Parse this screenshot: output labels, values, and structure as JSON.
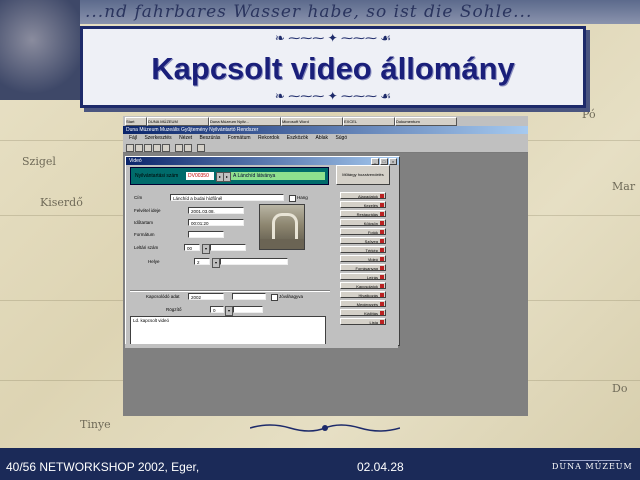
{
  "slide": {
    "script_text": "...nd fahrbares Wasser habe, so ist die Sohle...",
    "title": "Kapcsolt video állomány",
    "map_labels": [
      "Kiserdő",
      "Szigel",
      "Tinye",
      "Mar",
      "Pó",
      "Do"
    ],
    "footer_left": "40/56 NETWORKSHOP 2002, Eger,",
    "footer_date": "02.04.28",
    "footer_logo": "DUNA MÚZEUM"
  },
  "screen": {
    "taskbar_items": [
      "Start",
      "DUNA MÚZEUM",
      "Duna Múzeum Nyilv...",
      "Microsoft Word",
      "EXCEL",
      "Dokumentum"
    ],
    "app_title": "Duna Múzeum Muzeális Gyűjtemény Nyilvántartó Rendszer",
    "menu_items": [
      "Fájl",
      "Szerkesztés",
      "Nézet",
      "Beszúrás",
      "Formátum",
      "Rekordok",
      "Eszközök",
      "Ablak",
      "Súgó"
    ]
  },
  "form": {
    "title": "Videó",
    "teal_label": "Nyilvántartási szám",
    "code": "DV00350",
    "record_name": "A Lánchíd látványa",
    "fields": [
      {
        "label": "Cím",
        "value": "Lánchíd a budai hídfőnél"
      },
      {
        "label": "Felvétel ideje",
        "value": "2001.03.08."
      },
      {
        "label": "Időtartam",
        "value": "00:01:20"
      },
      {
        "label": "Formátum",
        "value": ""
      },
      {
        "label": "Leltári szám",
        "value": "00"
      },
      {
        "label": "Helye",
        "value": "2"
      }
    ],
    "checkbox_label": "Hang",
    "bottom_label_1": "Kapcsolódó adat",
    "bottom_value_1": "2002",
    "bottom_check_label": "Jóváhagyva",
    "bottom_label_2": "Rögzítő",
    "bottom_value_2": "0",
    "grid_row": "Ld. kapcsolt videó"
  },
  "side_buttons": {
    "top": "Műtárgy hozzárendelés",
    "items": [
      "Alapadatok",
      "Kezelés",
      "Restaurálás",
      "Kölcsön",
      "Fotók",
      "Szöveg",
      "Térkép",
      "Videó",
      "Forrásanyag",
      "Leírás",
      "Kapcsolatok",
      "Hivatkozás",
      "Megjegyzés",
      "Kiállítás",
      "Lista"
    ]
  }
}
